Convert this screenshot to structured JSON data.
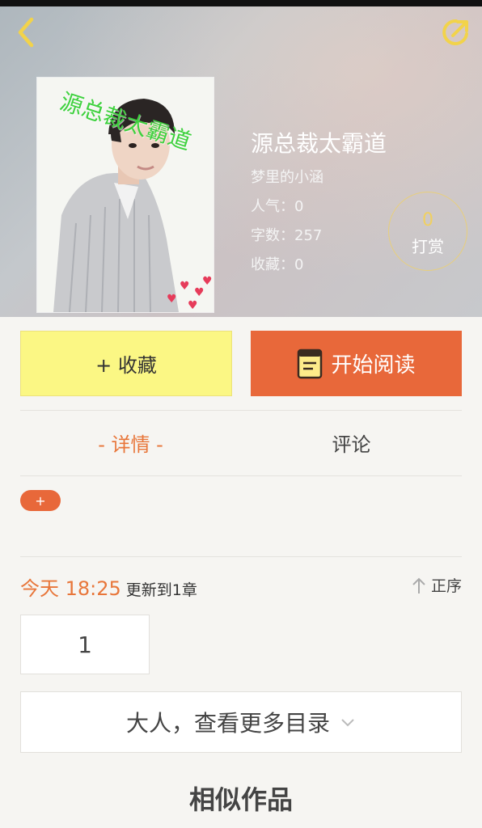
{
  "book": {
    "title": "源总裁太霸道",
    "cover_title": "源总裁太霸道",
    "author": "梦里的小涵",
    "popularity": "人气：0",
    "word_count": "字数：257",
    "favorites": "收藏：0"
  },
  "tip": {
    "count": "0",
    "label": "打赏"
  },
  "actions": {
    "favorite_label": "+ 收藏",
    "read_label": "开始阅读"
  },
  "tabs": [
    {
      "label": "- 详情 -",
      "active": true
    },
    {
      "label": "评论",
      "active": false
    }
  ],
  "tag_add_label": "+",
  "update": {
    "time": "今天 18:25",
    "text": "更新到1章",
    "sort_label": "正序"
  },
  "chapters": [
    "1"
  ],
  "more_catalog_label": "大人，查看更多目录",
  "similar_title": "相似作品",
  "colors": {
    "accent": "#e8683a",
    "favorite_bg": "#fbf784",
    "tip_gold": "#f0d060",
    "cover_title_green": "#3ed13e"
  },
  "icons": [
    "back-chevron-icon",
    "share-icon",
    "book-icon",
    "arrow-up-icon",
    "chevron-down-icon"
  ]
}
